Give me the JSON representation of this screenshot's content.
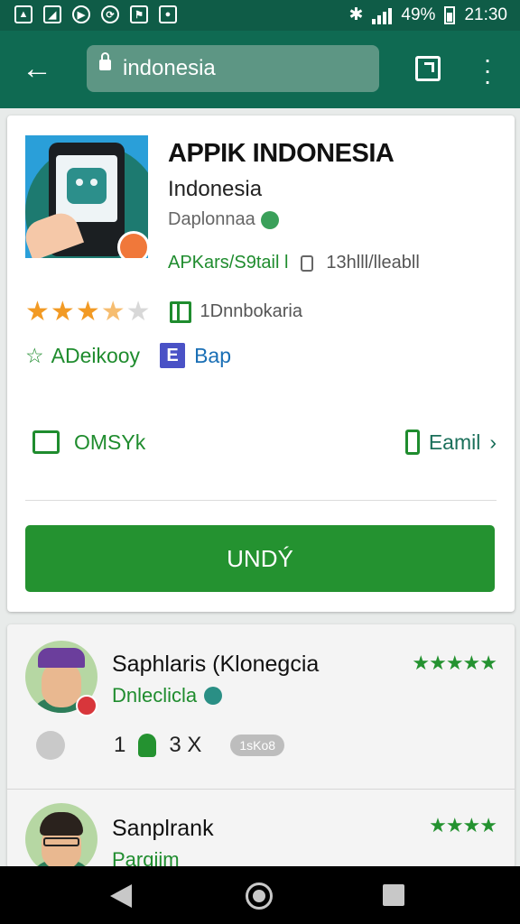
{
  "status_bar": {
    "battery": "49%",
    "time": "21:30"
  },
  "toolbar": {
    "url": "indonesia"
  },
  "app": {
    "title": "APPIK INDONESIA",
    "subtitle": "Indonesia",
    "developer": "Daplonnaa",
    "meta_left": "APKars/S9tail l",
    "meta_right": "13hlll/lleabll",
    "rating": 3.5,
    "category": "1Dnnbokaria",
    "tag_a": "ADeikooy",
    "tag_b": "Bap",
    "share_label": "OMSYk",
    "email_label": "Eamil",
    "install_label": "UNDÝ"
  },
  "reviews": [
    {
      "name": "Saphlaris (Klonegcia",
      "subtitle": "Dnleclicla",
      "stars": 5,
      "count_left": "1",
      "count_right": "3 X",
      "pill": "1sKo8"
    },
    {
      "name": "Sanplrank",
      "subtitle": "Parqiim",
      "stars": 4
    }
  ],
  "colors": {
    "brand_green": "#249230",
    "appbar": "#0f6a52",
    "star": "#f29a24"
  }
}
